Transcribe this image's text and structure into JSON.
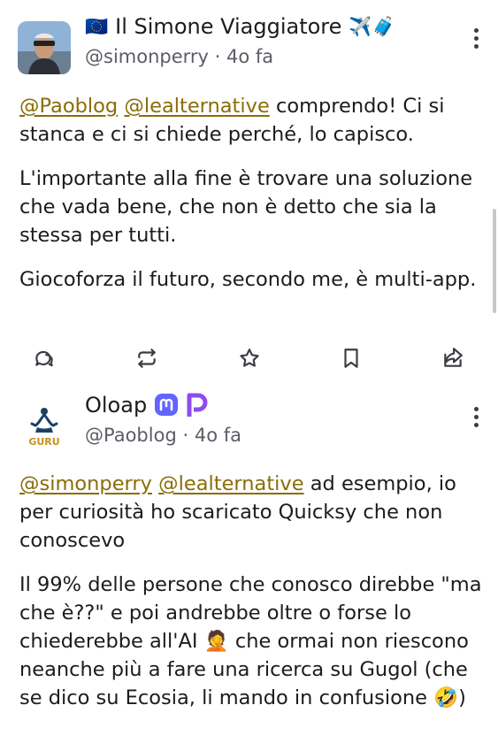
{
  "posts": [
    {
      "display_name": "Il Simone Viaggiatore",
      "name_prefix_emoji": "🇪🇺",
      "name_suffix_emoji": "✈️🧳",
      "handle": "@simonperry",
      "separator": "·",
      "time": "4o fa",
      "paragraphs": [
        {
          "mentions": [
            "@Paoblog",
            "@lealternative"
          ],
          "text": "comprendo! Ci si stanca e ci si chiede perché, lo capisco."
        },
        {
          "text": "L'importante alla fine è trovare una soluzione che vada bene, che non è detto che sia la stessa per tutti."
        },
        {
          "text": "Giocoforza il futuro, secondo me, è multi-app."
        }
      ],
      "actions": [
        "reply-icon",
        "boost-icon",
        "favourite-icon",
        "bookmark-icon",
        "share-icon"
      ]
    },
    {
      "display_name": "Oloap",
      "avatar_text": "GURU",
      "handle": "@Paoblog",
      "separator": "·",
      "time": "4o fa",
      "paragraphs": [
        {
          "mentions": [
            "@simonperry",
            "@lealternative"
          ],
          "text": "ad esempio, io per curiosità ho scaricato Quicksy che non conoscevo"
        },
        {
          "text": "Il 99% delle persone che conosco direbbe \"ma che è??\" e poi andrebbe oltre o forse lo chiederebbe all'AI 🤦 che ormai non riescono neanche più a fare una ricerca su Gugol (che se dico su Ecosia, li mando in confusione 🤣)"
        }
      ]
    }
  ],
  "colors": {
    "mention": "#8a6d08",
    "mastodon": "#6364ff",
    "pixelfed": "#8c4cf0"
  }
}
